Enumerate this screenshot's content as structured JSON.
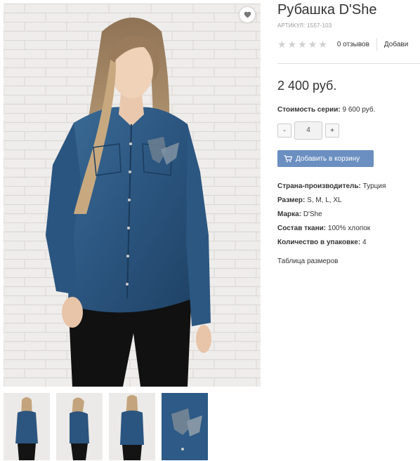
{
  "product": {
    "title": "Рубашка D'She",
    "sku_label": "Артикул:",
    "sku_value": "1557-103",
    "rating": 0,
    "reviews_text": "0 отзывов",
    "add_review_text": "Добави",
    "price": "2 400 руб.",
    "series_label": "Стоимость серии:",
    "series_value": "9 600 руб.",
    "quantity": "4",
    "minus_label": "-",
    "plus_label": "+",
    "cart_button": "Добавить в корзину",
    "properties": [
      {
        "label": "Страна-производитель:",
        "value": "Турция"
      },
      {
        "label": "Размер:",
        "value": "S, M, L, XL"
      },
      {
        "label": "Марка:",
        "value": "D'She"
      },
      {
        "label": "Состав ткани:",
        "value": "100% хлопок"
      },
      {
        "label": "Количество в упаковке:",
        "value": "4"
      }
    ],
    "size_table_link": "Таблица размеров"
  },
  "icons": {
    "favorite": "heart-icon",
    "cart": "cart-icon",
    "star": "star-icon"
  },
  "colors": {
    "accent_button": "#6b8fc0",
    "star_empty": "#d0d0d0",
    "denim": "#2c5680"
  }
}
